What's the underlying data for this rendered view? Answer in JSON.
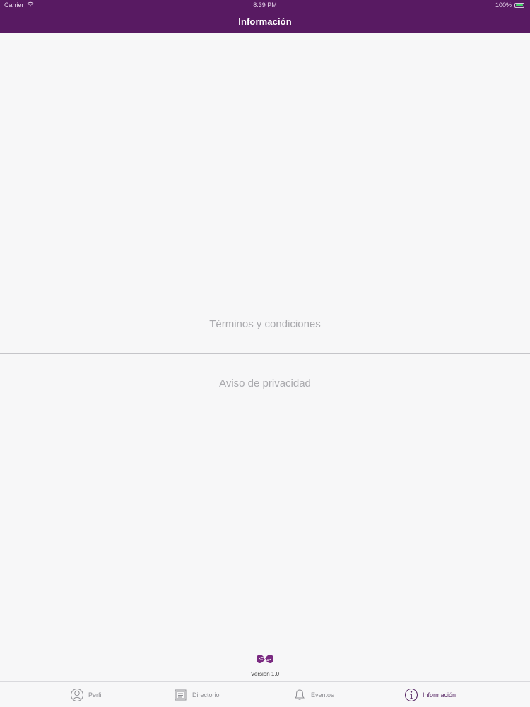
{
  "status_bar": {
    "carrier": "Carrier",
    "time": "8:39 PM",
    "battery": "100%"
  },
  "header": {
    "title": "Información"
  },
  "main": {
    "items": [
      {
        "label": "Términos y condiciones"
      },
      {
        "label": "Aviso de privacidad"
      }
    ],
    "version": "Versión 1.0"
  },
  "tabs": [
    {
      "label": "Perfil",
      "icon": "profile-icon"
    },
    {
      "label": "Directorio",
      "icon": "directory-icon"
    },
    {
      "label": "Eventos",
      "icon": "bell-icon"
    },
    {
      "label": "Información",
      "icon": "info-icon",
      "selected": true
    }
  ],
  "colors": {
    "header": "#581a62",
    "active_tab": "#5b2b68",
    "inactive_tab": "#8f8f94",
    "background": "#f7f7f8"
  }
}
